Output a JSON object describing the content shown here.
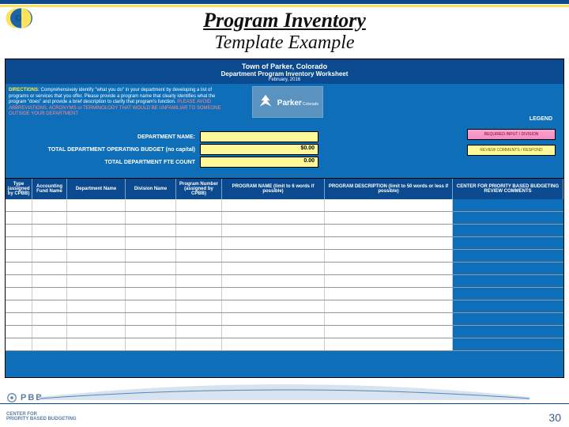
{
  "title": {
    "line1": "Program Inventory",
    "line2": "Template Example"
  },
  "sheet_header": {
    "town": "Town of Parker, Colorado",
    "worksheet": "Department Program Inventory Worksheet",
    "date": "February, 2016"
  },
  "directions": {
    "label": "DIRECTIONS:",
    "body": "Comprehensively identify \"what you do\" in your department by developing a list of programs or services that you offer. Please provide a program name that clearly identifies what the program \"does\" and provide a brief description to clarify that program's function.",
    "warn": "PLEASE AVOID ABBREVIATIONS, ACRONYMS or TERMINOLOGY THAT WOULD BE UNFAMILIAR TO SOMEONE OUTSIDE YOUR DEPARTMENT"
  },
  "parker": {
    "name": "Parker",
    "sub": "Colorado"
  },
  "legend": {
    "title": "LEGEND",
    "red": "REQUIRED INPUT / DIVISION",
    "yellow": "REVIEW COMMENTS / RESPOND"
  },
  "dept": {
    "name_label": "DEPARTMENT NAME:",
    "name_value": "",
    "budget_label": "TOTAL DEPARTMENT OPERATING BUDGET (no capital)",
    "budget_value": "$0.00",
    "fte_label": "TOTAL DEPARTMENT FTE COUNT",
    "fte_value": "0.00"
  },
  "table_headers": {
    "c1": "Type (assigned by CPBB)",
    "c2": "Accounting Fund Name",
    "c3": "Department Name",
    "c4": "Division Name",
    "c5": "Program Number (assigned by CPBB)",
    "c6": "PROGRAM NAME (limit to 6 words if possible)",
    "c7": "PROGRAM DESCRIPTION (limit to 50 words or less if possible)",
    "c8": "CENTER FOR PRIORITY BASED BUDGETING REVIEW COMMENTS"
  },
  "row_count": 12,
  "footer": {
    "pbb": "PBB",
    "center_for": "CENTER FOR\nPRIORITY BASED BUDGETING"
  },
  "page_number": "30"
}
